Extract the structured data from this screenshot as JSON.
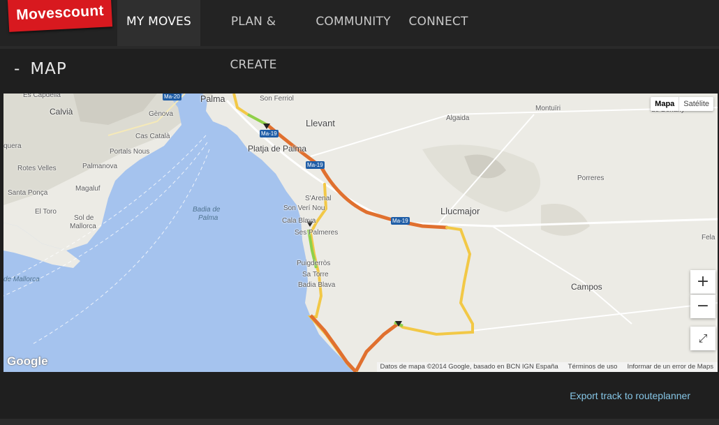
{
  "brand": {
    "logo_text": "Movescount",
    "color": "#d8191f"
  },
  "nav": {
    "items": [
      {
        "label": "MY MOVES",
        "active": true
      },
      {
        "label": "PLAN & CREATE",
        "active": false
      },
      {
        "label": "COMMUNITY",
        "active": false
      },
      {
        "label": "CONNECT",
        "active": false
      }
    ]
  },
  "section": {
    "collapse_symbol": "-",
    "title": "MAP"
  },
  "map": {
    "type_options": [
      "Mapa",
      "Satélite"
    ],
    "selected_type": "Mapa",
    "zoom_in": "+",
    "zoom_out": "−",
    "fullscreen_icon": "expand-icon",
    "google_logo": "Google",
    "attribution": "Datos de mapa ©2014 Google, basado en BCN IGN España",
    "terms_link": "Términos de uso",
    "report_link": "Informar de un error de Maps",
    "places": {
      "palma": "Palma",
      "son_ferriol": "Son Ferriol",
      "montuiri": "Montuïri",
      "vilafranca_1": "Vi",
      "vilafranca_2": "de Bonany",
      "calvia": "Calvià",
      "genova": "Gènova",
      "es_capdella": "Es Capdella",
      "llevant": "Llevant",
      "algaida": "Algaida",
      "cas_catala": "Cas Català",
      "portals_nous": "Portals Nous",
      "platja": "Platja de Palma",
      "quera": "quera",
      "palmanova": "Palmanova",
      "rotes_velles": "Rotes Velles",
      "magaluf": "Magaluf",
      "santa_ponca": "Santa Ponça",
      "el_toro": "El Toro",
      "sol_1": "Sol de",
      "sol_2": "Mallorca",
      "badia_1": "Badia de",
      "badia_2": "Palma",
      "sarenal": "S'Arenal",
      "son_veri": "Son Verí Nou",
      "cala_blava": "Cala Blava",
      "ses_palmeres": "Ses Palmeres",
      "llucmajor": "Llucmajor",
      "porreres": "Porreres",
      "felanitx": "Fela",
      "puigderros": "Puigderròs",
      "sa_torre": "Sa Torre",
      "badia_blava": "Badia Blava",
      "de_mallorca": "de Mallorca",
      "campos": "Campos"
    },
    "roads": {
      "ma20": "Ma-20",
      "ma19a": "Ma-19",
      "ma19b": "Ma-19",
      "ma19c": "Ma-19"
    }
  },
  "export_link": "Export track to routeplanner",
  "colors": {
    "background": "#1f1f1f",
    "sea": "#a5c3ee",
    "land": "#ecebe5",
    "track_orange": "#e0702f",
    "track_yellow": "#f2c846",
    "track_green": "#8ed04b",
    "link": "#86c6e6"
  }
}
